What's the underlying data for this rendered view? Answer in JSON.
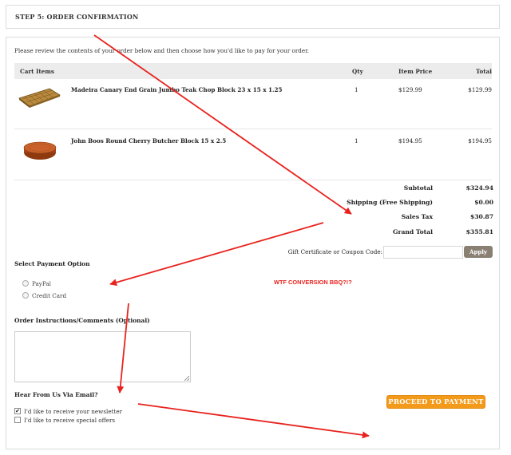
{
  "step": {
    "title": "STEP 5: ORDER CONFIRMATION"
  },
  "intro": "Please review the contents of your order below and then choose how you'd like to pay for your order.",
  "cart": {
    "headers": {
      "item": "Cart Items",
      "qty": "Qty",
      "price": "Item Price",
      "total": "Total"
    },
    "items": [
      {
        "name": "Madeira Canary End Grain Jumbo Teak Chop Block 23 x 15 x 1.25",
        "qty": "1",
        "price": "$129.99",
        "total": "$129.99"
      },
      {
        "name": "John Boos Round Cherry Butcher Block 15 x 2.5",
        "qty": "1",
        "price": "$194.95",
        "total": "$194.95"
      }
    ]
  },
  "summary": {
    "subtotal_label": "Subtotal",
    "subtotal": "$324.94",
    "shipping_label": "Shipping (Free Shipping)",
    "shipping": "$0.00",
    "tax_label": "Sales Tax",
    "tax": "$30.87",
    "grand_label": "Grand Total",
    "grand": "$355.81"
  },
  "gift": {
    "label": "Gift Certificate or Coupon Code:",
    "value": "",
    "apply": "Apply"
  },
  "payment": {
    "label": "Select Payment Option",
    "options": [
      "PayPal",
      "Credit Card"
    ]
  },
  "comments": {
    "label": "Order Instructions/Comments (Optional)",
    "value": ""
  },
  "annotation": "WTF CONVERSION BBQ?!?",
  "email": {
    "label": "Hear From Us Via Email?",
    "newsletter": "I'd like to receive your newsletter",
    "newsletter_checked": true,
    "offers": "I'd like to receive special offers",
    "offers_checked": false
  },
  "proceed": "PROCEED TO PAYMENT",
  "colors": {
    "accent": "#f39a1b",
    "annotation_red": "#e8231e",
    "apply_button": "#8a7f73"
  }
}
